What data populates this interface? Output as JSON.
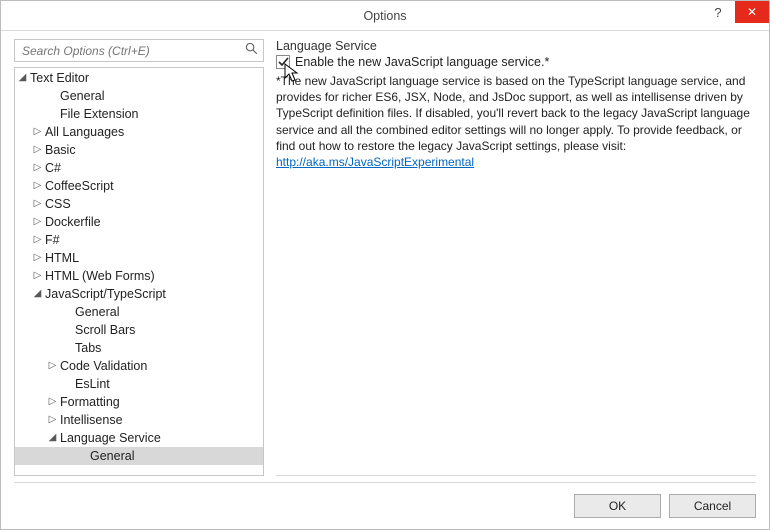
{
  "window": {
    "title": "Options",
    "help_glyph": "?",
    "close_glyph": "✕"
  },
  "search": {
    "placeholder": "Search Options (Ctrl+E)",
    "icon": "🔍"
  },
  "tree": {
    "root": "Text Editor",
    "items": [
      {
        "label": "General",
        "arrow": "",
        "indent": 2
      },
      {
        "label": "File Extension",
        "arrow": "",
        "indent": 2
      },
      {
        "label": "All Languages",
        "arrow": "▷",
        "indent": 1
      },
      {
        "label": "Basic",
        "arrow": "▷",
        "indent": 1
      },
      {
        "label": "C#",
        "arrow": "▷",
        "indent": 1
      },
      {
        "label": "CoffeeScript",
        "arrow": "▷",
        "indent": 1
      },
      {
        "label": "CSS",
        "arrow": "▷",
        "indent": 1
      },
      {
        "label": "Dockerfile",
        "arrow": "▷",
        "indent": 1
      },
      {
        "label": "F#",
        "arrow": "▷",
        "indent": 1
      },
      {
        "label": "HTML",
        "arrow": "▷",
        "indent": 1
      },
      {
        "label": "HTML (Web Forms)",
        "arrow": "▷",
        "indent": 1
      },
      {
        "label": "JavaScript/TypeScript",
        "arrow": "◢",
        "indent": 1,
        "open": true
      },
      {
        "label": "General",
        "arrow": "",
        "indent": 3
      },
      {
        "label": "Scroll Bars",
        "arrow": "",
        "indent": 3
      },
      {
        "label": "Tabs",
        "arrow": "",
        "indent": 3
      },
      {
        "label": "Code Validation",
        "arrow": "▷",
        "indent": 2
      },
      {
        "label": "EsLint",
        "arrow": "",
        "indent": 3
      },
      {
        "label": "Formatting",
        "arrow": "▷",
        "indent": 2
      },
      {
        "label": "Intellisense",
        "arrow": "▷",
        "indent": 2
      },
      {
        "label": "Language Service",
        "arrow": "◢",
        "indent": 2,
        "open": true
      },
      {
        "label": "General",
        "arrow": "",
        "indent": 4,
        "sel": true
      }
    ]
  },
  "panel": {
    "heading": "Language Service",
    "checkbox_label": "Enable the new JavaScript language service.*",
    "checkbox_checked": true,
    "desc_prefix": "*The new JavaScript language service is based on the TypeScript language service, and provides for richer ES6, JSX, Node, and JsDoc support, as well as intellisense driven by TypeScript definition files. If disabled, you'll revert back to the legacy JavaScript language service and all the combined editor settings will no longer apply. To provide feedback, or find out how to restore the legacy JavaScript settings, please visit: ",
    "link_text": "http://aka.ms/JavaScriptExperimental",
    "link_href": "http://aka.ms/JavaScriptExperimental"
  },
  "buttons": {
    "ok": "OK",
    "cancel": "Cancel"
  }
}
